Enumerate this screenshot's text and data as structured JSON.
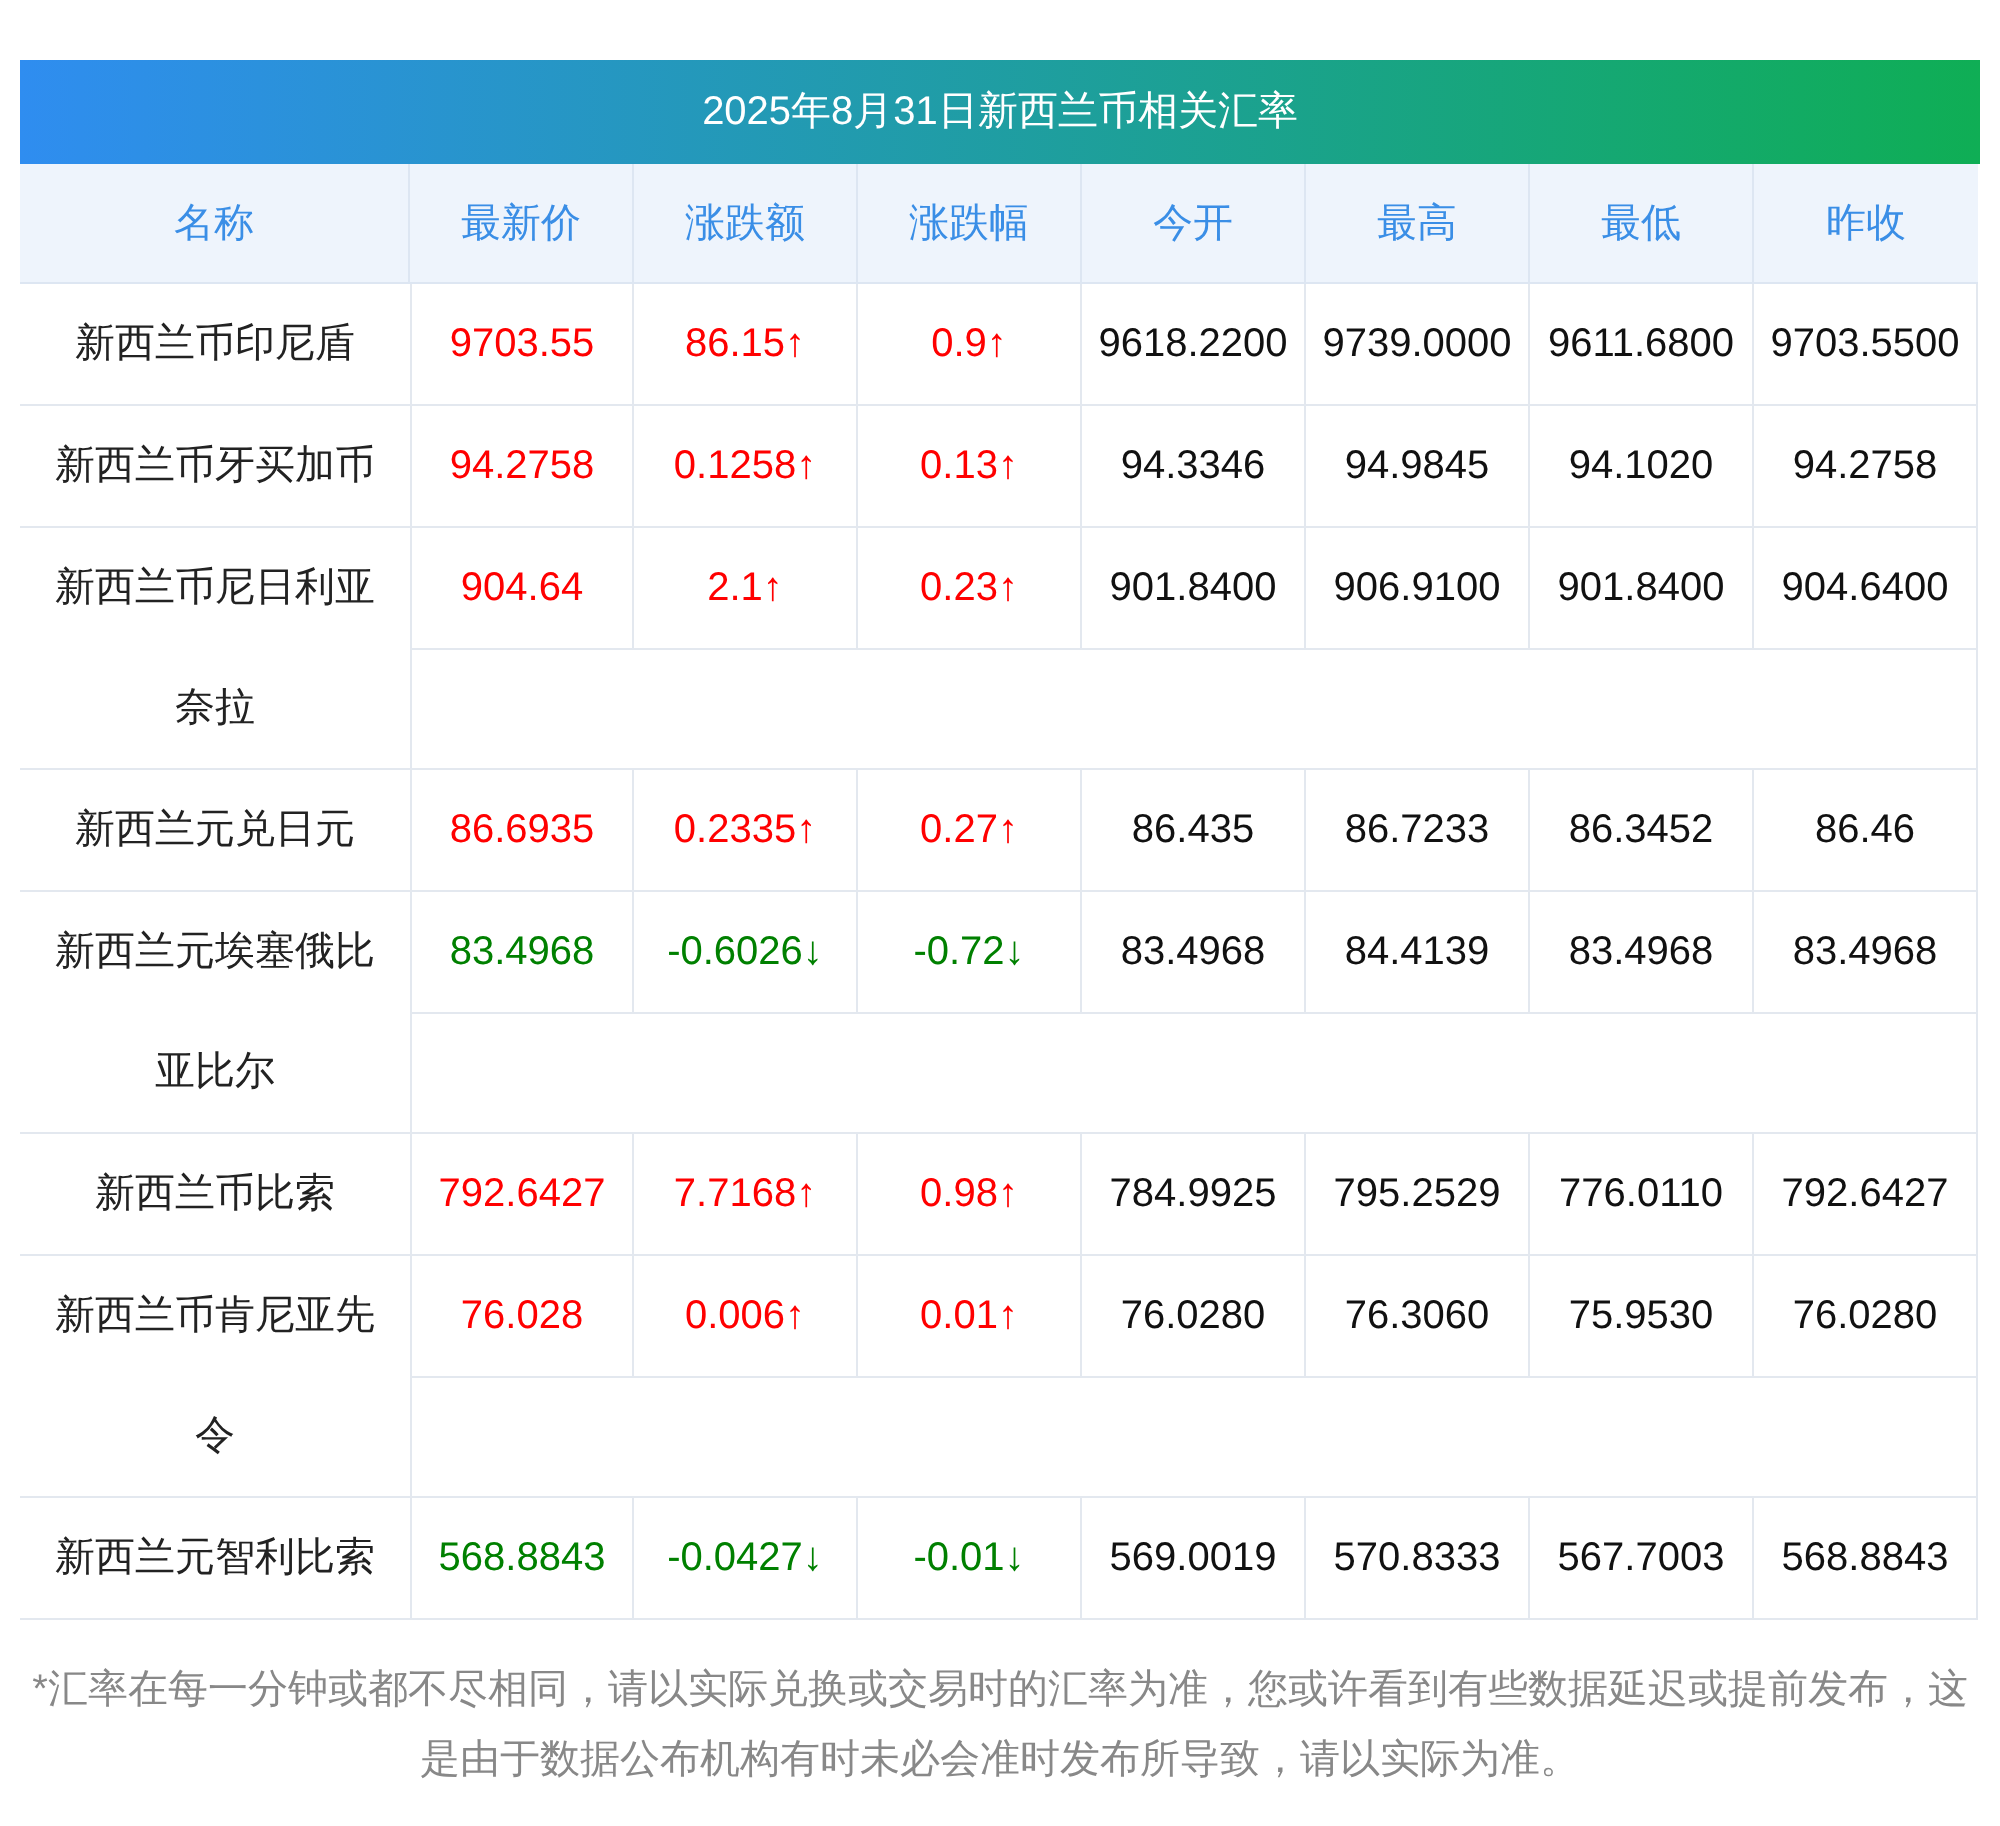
{
  "table": {
    "title": "2025年8月31日新西兰币相关汇率",
    "columns": [
      "名称",
      "最新价",
      "涨跌额",
      "涨跌幅",
      "今开",
      "最高",
      "最低",
      "昨收"
    ],
    "rows": [
      {
        "name": "新西兰币印尼盾",
        "color": "#ff0000",
        "latest": "9703.55",
        "change": "86.15↑",
        "pct": "0.9↑",
        "open": "9618.2200",
        "high": "9739.0000",
        "low": "9611.6800",
        "prev": "9703.5500"
      },
      {
        "name": "新西兰币牙买加币",
        "color": "#ff0000",
        "latest": "94.2758",
        "change": "0.1258↑",
        "pct": "0.13↑",
        "open": "94.3346",
        "high": "94.9845",
        "low": "94.1020",
        "prev": "94.2758"
      },
      {
        "name": "新西兰币尼日利亚奈拉",
        "color": "#ff0000",
        "latest": "904.64",
        "change": "2.1↑",
        "pct": "0.23↑",
        "open": "901.8400",
        "high": "906.9100",
        "low": "901.8400",
        "prev": "904.6400"
      },
      {
        "name": "新西兰元兑日元",
        "color": "#ff0000",
        "latest": "86.6935",
        "change": "0.2335↑",
        "pct": "0.27↑",
        "open": "86.435",
        "high": "86.7233",
        "low": "86.3452",
        "prev": "86.46"
      },
      {
        "name": "新西兰元埃塞俄比亚比尔",
        "color": "#008000",
        "latest": "83.4968",
        "change": "-0.6026↓",
        "pct": "-0.72↓",
        "open": "83.4968",
        "high": "84.4139",
        "low": "83.4968",
        "prev": "83.4968"
      },
      {
        "name": "新西兰币比索",
        "color": "#ff0000",
        "latest": "792.6427",
        "change": "7.7168↑",
        "pct": "0.98↑",
        "open": "784.9925",
        "high": "795.2529",
        "low": "776.0110",
        "prev": "792.6427"
      },
      {
        "name": "新西兰币肯尼亚先令",
        "color": "#ff0000",
        "latest": "76.028",
        "change": "0.006↑",
        "pct": "0.01↑",
        "open": "76.0280",
        "high": "76.3060",
        "low": "75.9530",
        "prev": "76.0280"
      },
      {
        "name": "新西兰元智利比索",
        "color": "#008000",
        "latest": "568.8843",
        "change": "-0.0427↓",
        "pct": "-0.01↓",
        "open": "569.0019",
        "high": "570.8333",
        "low": "567.7003",
        "prev": "568.8843"
      }
    ]
  },
  "footnote": "*汇率在每一分钟或都不尽相同，请以实际兑换或交易时的汇率为准，您或许看到有些数据延迟或提前发布，这是由于数据公布机构有时未必会准时发布所导致，请以实际为准。"
}
